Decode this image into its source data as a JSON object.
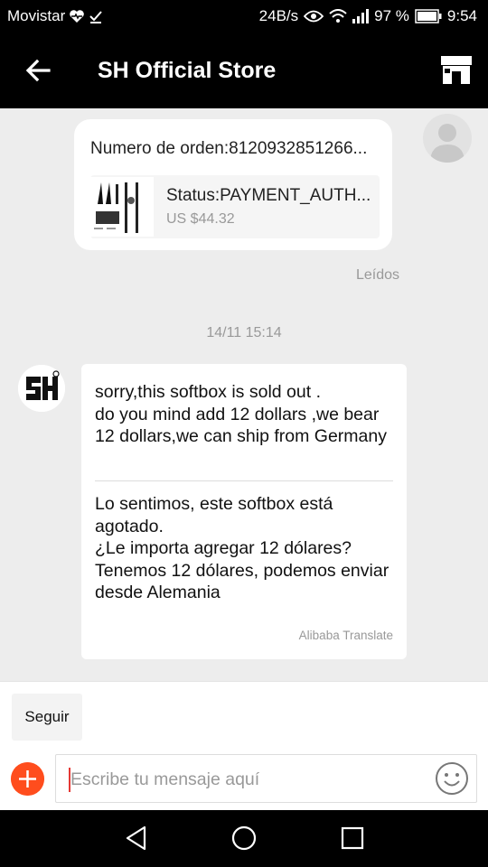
{
  "status_bar": {
    "carrier": "Movistar",
    "network_speed": "24B/s",
    "battery_percent": "97 %",
    "time": "9:54",
    "icons": [
      "heart-monitor-icon",
      "download-check-icon",
      "eye-icon",
      "wifi-icon",
      "signal-icon",
      "battery-icon"
    ]
  },
  "header": {
    "title": "SH Official Store",
    "icons": [
      "back-arrow-icon",
      "store-icon"
    ]
  },
  "order_card": {
    "order_number": "Numero de orden:8120932851266...",
    "status": "Status:PAYMENT_AUTH...",
    "price": "US $44.32"
  },
  "read_label": "Leídos",
  "timestamp": "14/11 15:14",
  "message": {
    "sender_logo": "SH",
    "original": "sorry,this softbox is sold out .\ndo you mind add 12 dollars ,we bear 12 dollars,we can ship from Germany",
    "translated": "Lo sentimos, este softbox está agotado.\n¿Le importa agregar 12 dólares? Tenemos 12 dólares, podemos enviar desde Alemania",
    "translator_credit": "Alibaba Translate"
  },
  "footer": {
    "follow_label": "Seguir",
    "input_placeholder": "Escribe tu mensaje aquí",
    "icons": [
      "plus-icon",
      "emoji-icon"
    ]
  },
  "nav_bar": {
    "icons": [
      "back-triangle-icon",
      "home-circle-icon",
      "recents-square-icon"
    ]
  },
  "colors": {
    "app_bar": "#000000",
    "chat_background": "#ededed",
    "add_button": "#ff4d1d",
    "cursor": "#e53935"
  }
}
